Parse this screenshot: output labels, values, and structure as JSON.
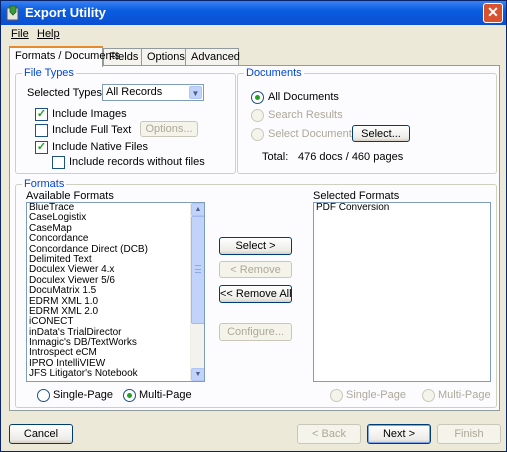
{
  "window": {
    "title": "Export Utility",
    "close_glyph": "✕",
    "icon": "app-icon"
  },
  "menu": {
    "file": "File",
    "help": "Help"
  },
  "tabs": [
    {
      "label": "Formats / Documents",
      "active": true
    },
    {
      "label": "Fields"
    },
    {
      "label": "Options"
    },
    {
      "label": "Advanced"
    }
  ],
  "file_types": {
    "group_label": "File Types",
    "selected_types_label": "Selected Types:",
    "selected_types_value": "All Records",
    "include_images": {
      "label": "Include Images",
      "checked": true
    },
    "include_full_text": {
      "label": "Include Full Text",
      "checked": false
    },
    "options_button": "Options...",
    "include_native": {
      "label": "Include Native Files",
      "checked": true
    },
    "include_without_files": {
      "label": "Include records without files",
      "checked": false
    }
  },
  "documents": {
    "group_label": "Documents",
    "all_documents": "All Documents",
    "search_results": "Search Results",
    "select_documents": "Select Documents",
    "select_button": "Select...",
    "total_label": "Total:",
    "total_value": "476 docs / 460 pages"
  },
  "formats": {
    "group_label": "Formats",
    "available_label": "Available Formats",
    "available": [
      "BlueTrace",
      "CaseLogistix",
      "CaseMap",
      "Concordance",
      "Concordance Direct (DCB)",
      "Delimited Text",
      "Doculex Viewer 4.x",
      "Doculex Viewer 5/6",
      "DocuMatrix 1.5",
      "EDRM XML 1.0",
      "EDRM XML 2.0",
      "iCONECT",
      "inData's TrialDirector",
      "Inmagic's DB/TextWorks",
      "Introspect eCM",
      "IPRO IntelliVIEW",
      "JFS Litigator's Notebook"
    ],
    "selected_label": "Selected Formats",
    "selected": [
      "PDF Conversion"
    ],
    "buttons": {
      "select": "Select >",
      "remove": "< Remove",
      "remove_all": "<< Remove All",
      "configure": "Configure..."
    },
    "left_single_page": "Single-Page",
    "left_multi_page": "Multi-Page",
    "right_single_page": "Single-Page",
    "right_multi_page": "Multi-Page"
  },
  "footer": {
    "cancel": "Cancel",
    "back": "< Back",
    "next": "Next >",
    "finish": "Finish"
  }
}
